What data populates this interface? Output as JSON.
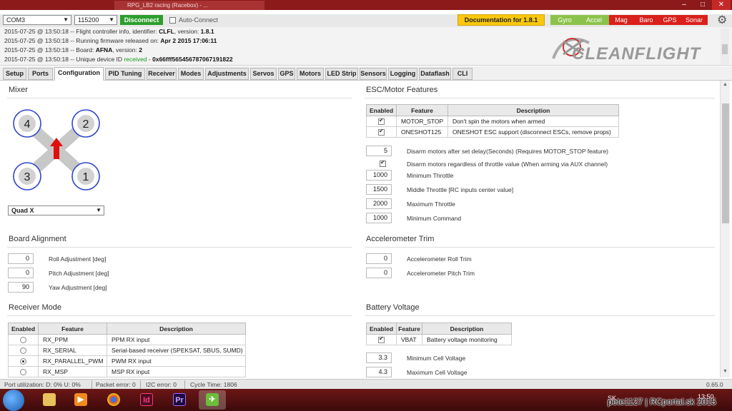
{
  "titlebar": {
    "tab_text": "RPG_LB2 racing (Racebox) - ..."
  },
  "window": {
    "minimize": "–",
    "maximize": "□",
    "close": "✕"
  },
  "connection": {
    "port": "COM3",
    "baud": "115200",
    "disconnect_label": "Disconnect",
    "auto_connect_label": "Auto-Connect",
    "auto_connect": false
  },
  "documentation_label": "Documentation for 1.8.1",
  "sensors": [
    {
      "name": "Gyro",
      "color": "#8bc34a"
    },
    {
      "name": "Accel",
      "color": "#8bc34a"
    },
    {
      "name": "Mag",
      "color": "#d9201c"
    },
    {
      "name": "Baro",
      "color": "#d9201c"
    },
    {
      "name": "GPS",
      "color": "#d9201c"
    },
    {
      "name": "Sonar",
      "color": "#d9201c"
    }
  ],
  "log": [
    {
      "prefix": "2015-07-25 @ 13:50:18 -- Flight controller info, identifier: ",
      "bold": "CLFL",
      "suffix": ", version: ",
      "bold2": "1.8.1"
    },
    {
      "prefix": "2015-07-25 @ 13:50:18 -- Running firmware released on: ",
      "bold": "Apr 2 2015 17:06:11",
      "suffix": "",
      "bold2": ""
    },
    {
      "prefix": "2015-07-25 @ 13:50:18 -- Board: ",
      "bold": "AFNA",
      "suffix": ", version: ",
      "bold2": "2"
    },
    {
      "prefix": "2015-07-25 @ 13:50:18 -- Unique device ID ",
      "green": "received",
      "suffix": " - ",
      "bold2": "0x66fff565456787067191822"
    }
  ],
  "logo_text": "CLEANFLIGHT",
  "tabs": [
    "Setup",
    "Ports",
    "Configuration",
    "PID Tuning",
    "Receiver",
    "Modes",
    "Adjustments",
    "Servos",
    "GPS",
    "Motors",
    "LED Strip",
    "Sensors",
    "Logging",
    "Dataflash",
    "CLI"
  ],
  "active_tab": "Configuration",
  "mixer": {
    "title": "Mixer",
    "motors": [
      "4",
      "2",
      "3",
      "1"
    ],
    "selected": "Quad X"
  },
  "board_alignment": {
    "title": "Board Alignment",
    "fields": [
      {
        "value": "0",
        "label": "Roll Adjustment [deg]"
      },
      {
        "value": "0",
        "label": "Pitch Adjustment [deg]"
      },
      {
        "value": "90",
        "label": "Yaw Adjustment [deg]"
      }
    ]
  },
  "receiver_mode": {
    "title": "Receiver Mode",
    "headers": [
      "Enabled",
      "Feature",
      "Description"
    ],
    "rows": [
      {
        "on": false,
        "feature": "RX_PPM",
        "description": "PPM RX input"
      },
      {
        "on": false,
        "feature": "RX_SERIAL",
        "description": "Serial-based receiver (SPEKSAT, SBUS, SUMD)"
      },
      {
        "on": true,
        "feature": "RX_PARALLEL_PWM",
        "description": "PWM RX input"
      },
      {
        "on": false,
        "feature": "RX_MSP",
        "description": "MSP RX input"
      }
    ]
  },
  "esc": {
    "title": "ESC/Motor Features",
    "headers": [
      "Enabled",
      "Feature",
      "Description"
    ],
    "rows": [
      {
        "on": true,
        "feature": "MOTOR_STOP",
        "description": "Don't spin the motors when armed"
      },
      {
        "on": true,
        "feature": "ONESHOT125",
        "description": "ONESHOT ESC support (disconnect ESCs, remove props)"
      }
    ],
    "disarm_delay": {
      "value": "5",
      "label": "Disarm motors after set delay(Seconds) (Requires MOTOR_STOP feature)"
    },
    "disarm_throttle": {
      "checked": true,
      "label": "Disarm motors regardless of throttle value (When arming via AUX channel)"
    },
    "fields": [
      {
        "value": "1000",
        "label": "Minimum Throttle"
      },
      {
        "value": "1500",
        "label": "Middle Throttle [RC inputs center value]"
      },
      {
        "value": "2000",
        "label": "Maximum Throttle"
      },
      {
        "value": "1000",
        "label": "Minimum Command"
      }
    ]
  },
  "acc_trim": {
    "title": "Accelerometer Trim",
    "fields": [
      {
        "value": "0",
        "label": "Accelerometer Roll Trim"
      },
      {
        "value": "0",
        "label": "Accelerometer Pitch Trim"
      }
    ]
  },
  "battery": {
    "title": "Battery Voltage",
    "headers": [
      "Enabled",
      "Feature",
      "Description"
    ],
    "rows": [
      {
        "on": true,
        "feature": "VBAT",
        "description": "Battery voltage monitoring"
      }
    ],
    "fields": [
      {
        "value": "3.3",
        "label": "Minimum Cell Voltage"
      },
      {
        "value": "4.3",
        "label": "Maximum Cell Voltage"
      }
    ]
  },
  "status": {
    "port_utilization": "Port utilization: D: 0% U: 0%",
    "packet_error": "Packet error: 0",
    "i2c_error": "I2C error: 0",
    "cycle_time": "Cycle Time: 1806",
    "version": "0.65.0"
  },
  "taskbar": {
    "lang": "SK",
    "time": "13:50",
    "overlay": "pete1127 | RCportal.sk 2015"
  }
}
